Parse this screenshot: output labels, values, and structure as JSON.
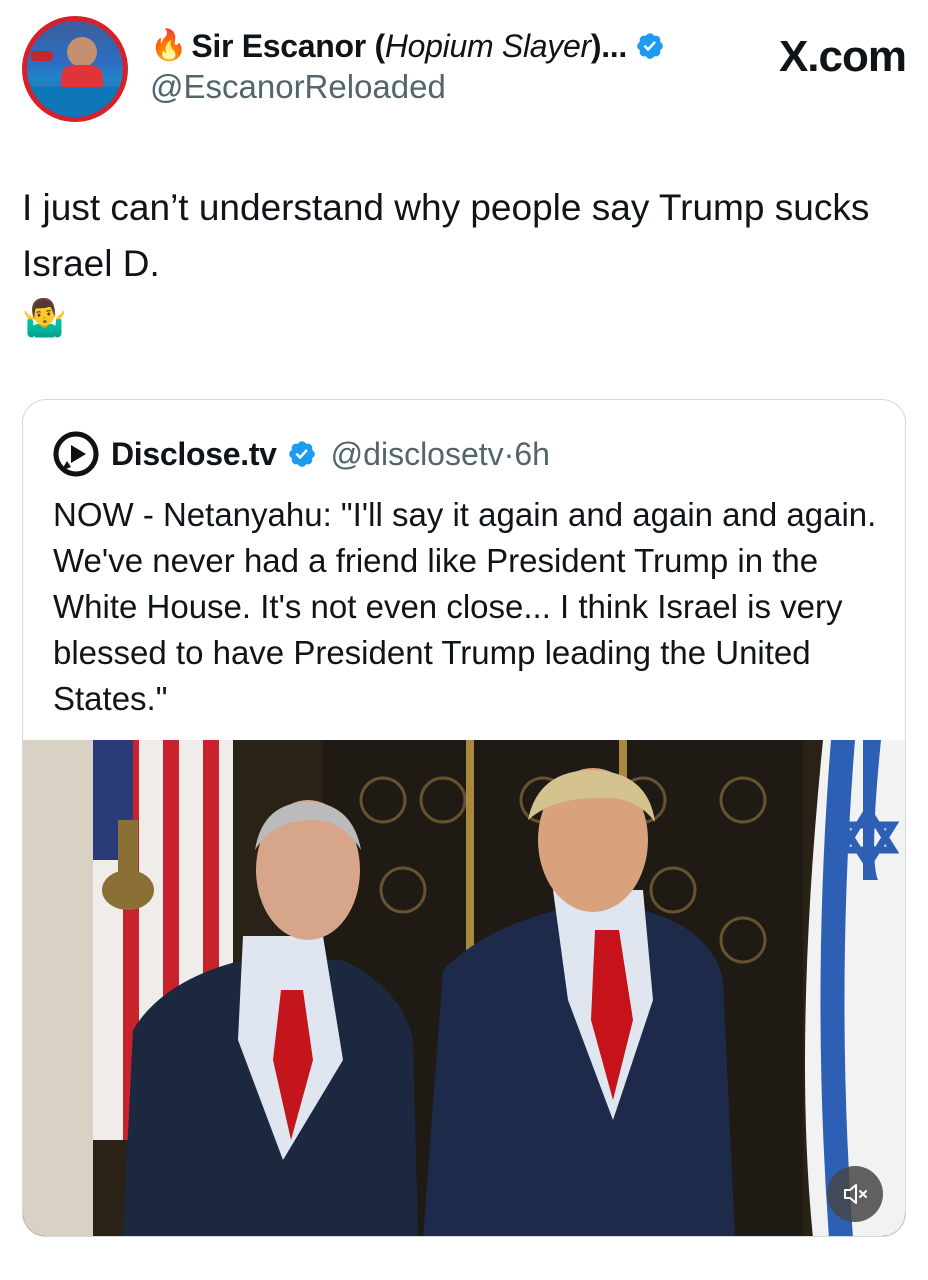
{
  "author": {
    "emoji": "🔥",
    "display_name": "Sir Escanor (",
    "display_name_italic": "Hopium Slayer",
    "display_name_suffix": ")...",
    "handle": "@EscanorReloaded"
  },
  "brand": {
    "site": "X.com"
  },
  "tweet": {
    "text": "I just can’t understand why people say Trump sucks Israel D.",
    "emoji": "🤷‍♂️"
  },
  "quoted": {
    "name": "Disclose.tv",
    "handle": "@disclosetv",
    "separator": "·",
    "time": "6h",
    "text": "NOW - Netanyahu: \"I'll say it again and again and again. We've never had a friend like President Trump in the White House. It's not even close... I think Israel is very blessed to have President Trump leading the United States.\""
  },
  "colors": {
    "verified": "#1d9bf0",
    "secondary_text": "#536471",
    "border": "#cfd9de"
  },
  "icons": {
    "verified": "verified-badge-icon",
    "disclose_logo": "disclose-tv-logo-icon",
    "mute": "mute-icon"
  }
}
